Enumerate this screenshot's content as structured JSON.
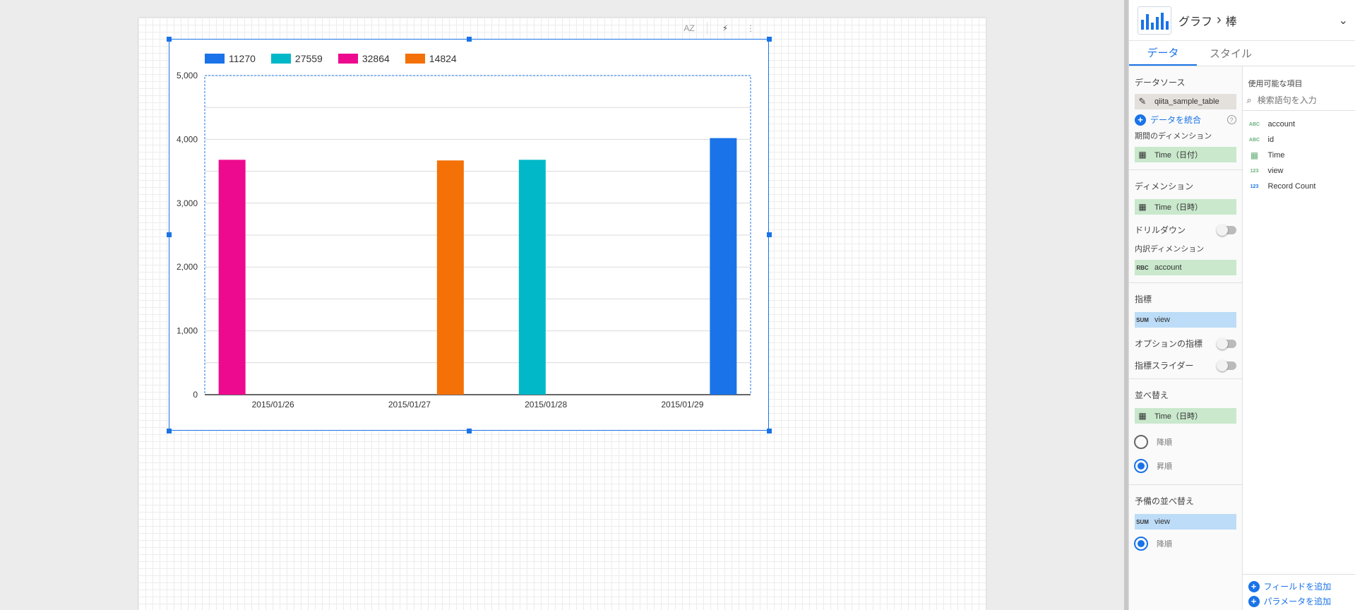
{
  "chart": {
    "toolbar": {
      "sort_label": "AZ",
      "flash_label": "⚡",
      "more_label": "⋮"
    },
    "legend": [
      {
        "label": "11270",
        "color": "#1a73e8"
      },
      {
        "label": "27559",
        "color": "#00b8c8"
      },
      {
        "label": "32864",
        "color": "#ee0a8e"
      },
      {
        "label": "14824",
        "color": "#f47108"
      }
    ]
  },
  "chart_data": {
    "type": "bar",
    "categories": [
      "2015/01/26",
      "2015/01/27",
      "2015/01/28",
      "2015/01/29"
    ],
    "series": [
      {
        "name": "11270",
        "color": "#1a73e8",
        "values": [
          null,
          null,
          null,
          4020
        ]
      },
      {
        "name": "27559",
        "color": "#00b8c8",
        "values": [
          null,
          null,
          3680,
          null
        ]
      },
      {
        "name": "32864",
        "color": "#ee0a8e",
        "values": [
          3680,
          null,
          null,
          null
        ]
      },
      {
        "name": "14824",
        "color": "#f47108",
        "values": [
          null,
          3670,
          null,
          null
        ]
      }
    ],
    "ylim": [
      0,
      5000
    ],
    "yticks": [
      "0",
      "1,000",
      "2,000",
      "3,000",
      "4,000",
      "5,000"
    ],
    "title": "",
    "xlabel": "",
    "ylabel": "",
    "legend_position": "top-left",
    "grid": true
  },
  "panel": {
    "title": "グラフ",
    "chevron": "›",
    "subtitle": "棒",
    "collapse": "⌄",
    "tabs": [
      "データ",
      "スタイル"
    ],
    "data_source_label": "データソース",
    "data_source_name": "qiita_sample_table",
    "blend_data": "データを統合",
    "help": "?",
    "date_dimension_label": "期間のディメンション",
    "date_dimension": "Time（日付）",
    "dimension_label": "ディメンション",
    "dimension": "Time（日時）",
    "drilldown_label": "ドリルダウン",
    "breakdown_label": "内訳ディメンション",
    "breakdown": "account",
    "metric_label": "指標",
    "metric_agg": "SUM",
    "metric": "view",
    "optional_metric_label": "オプションの指標",
    "metric_slider_label": "指標スライダー",
    "sort_label": "並べ替え",
    "sort_field": "Time（日時）",
    "sort_desc": "降順",
    "sort_asc": "昇順",
    "secondary_sort_label": "予備の並べ替え",
    "secondary_sort_agg": "SUM",
    "secondary_sort_field": "view",
    "secondary_sort_desc": "降順",
    "available_fields_label": "使用可能な項目",
    "search_placeholder": "検索語句を入力",
    "fields": [
      {
        "type": "ABC",
        "name": "account"
      },
      {
        "type": "ABC",
        "name": "id"
      },
      {
        "type": "CAL",
        "name": "Time"
      },
      {
        "type": "123",
        "name": "view"
      },
      {
        "type": "123",
        "name": "Record Count"
      }
    ],
    "add_field": "フィールドを追加",
    "add_parameter": "パラメータを追加"
  }
}
